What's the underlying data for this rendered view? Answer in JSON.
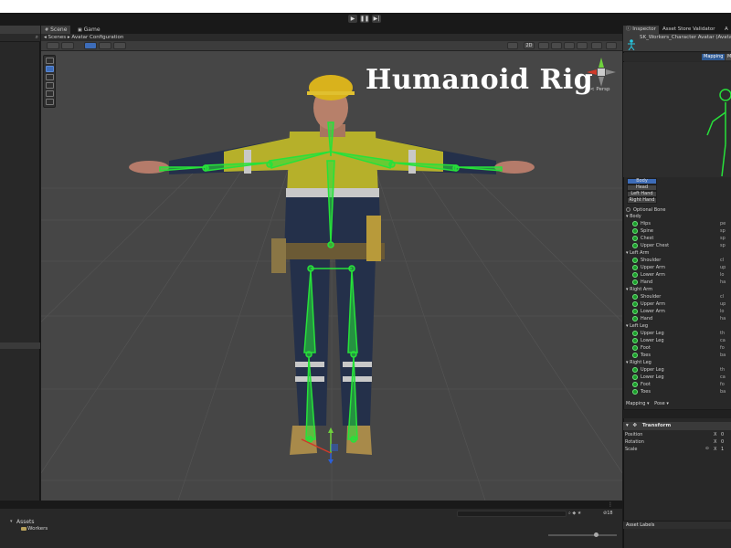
{
  "toolbar": {
    "play": "▶",
    "pause": "❚❚",
    "step": "▶|"
  },
  "scene_tabs": [
    {
      "label": "Scene"
    },
    {
      "label": "Game"
    }
  ],
  "breadcrumb": {
    "root": "Scenes",
    "current": "Avatar Configuration"
  },
  "scene_toolbar": {
    "shading_button": "2D"
  },
  "overlay_title": "Humanoid Rig",
  "viewport": {
    "gizmo_label": "< Persp"
  },
  "inspector": {
    "tabs": [
      "Inspector",
      "Asset Store Validator",
      "A"
    ],
    "object_name": "SK_Workers_Character Avatar (Avata",
    "mapping_tabs": [
      "Mapping",
      "M"
    ],
    "part_buttons": [
      "Body",
      "Head",
      "Left Hand",
      "Right Hand"
    ],
    "optional_bone": "Optional Bone",
    "groups": [
      {
        "name": "Body",
        "bones": [
          {
            "label": "Hips",
            "value": "pe"
          },
          {
            "label": "Spine",
            "value": "sp"
          },
          {
            "label": "Chest",
            "value": "sp"
          },
          {
            "label": "Upper Chest",
            "value": "sp"
          }
        ]
      },
      {
        "name": "Left Arm",
        "bones": [
          {
            "label": "Shoulder",
            "value": "cl"
          },
          {
            "label": "Upper Arm",
            "value": "up"
          },
          {
            "label": "Lower Arm",
            "value": "lo"
          },
          {
            "label": "Hand",
            "value": "ha"
          }
        ]
      },
      {
        "name": "Right Arm",
        "bones": [
          {
            "label": "Shoulder",
            "value": "cl"
          },
          {
            "label": "Upper Arm",
            "value": "up"
          },
          {
            "label": "Lower Arm",
            "value": "lo"
          },
          {
            "label": "Hand",
            "value": "ha"
          }
        ]
      },
      {
        "name": "Left Leg",
        "bones": [
          {
            "label": "Upper Leg",
            "value": "th"
          },
          {
            "label": "Lower Leg",
            "value": "ca"
          },
          {
            "label": "Foot",
            "value": "fo"
          },
          {
            "label": "Toes",
            "value": "ba"
          }
        ]
      },
      {
        "name": "Right Leg",
        "bones": [
          {
            "label": "Upper Leg",
            "value": "th"
          },
          {
            "label": "Lower Leg",
            "value": "ca"
          },
          {
            "label": "Foot",
            "value": "fo"
          },
          {
            "label": "Toes",
            "value": "ba"
          }
        ]
      }
    ],
    "mapping_menu": "Mapping ▾",
    "pose_menu": "Pose ▾",
    "transform": {
      "title": "Transform",
      "position": {
        "label": "Position",
        "axis": "X",
        "value": "0"
      },
      "rotation": {
        "label": "Rotation",
        "axis": "X",
        "value": "0"
      },
      "scale": {
        "label": "Scale",
        "axis": "X",
        "value": "1"
      }
    },
    "asset_labels": "Asset Labels"
  },
  "project": {
    "root": "Assets",
    "folder": "Workers",
    "count": "18"
  },
  "colors": {
    "bone_green": "#27e13a",
    "accent_blue": "#3d6cb8",
    "background": "#464646"
  }
}
